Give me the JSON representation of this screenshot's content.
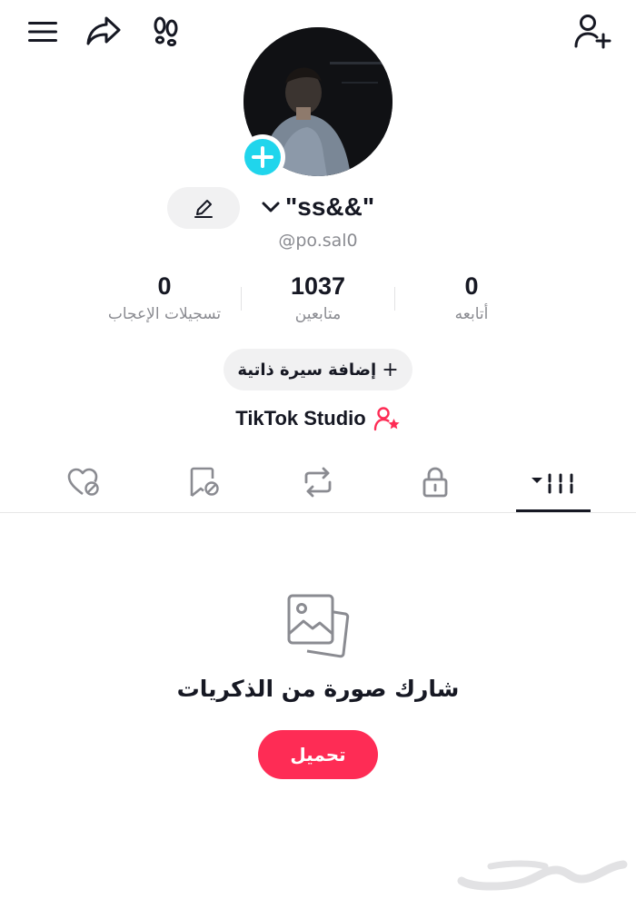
{
  "profile": {
    "display_name": "\"ss&&\"",
    "username": "@po.sal0"
  },
  "stats": [
    {
      "value": "0",
      "label": "تسجيلات الإعجاب"
    },
    {
      "value": "1037",
      "label": "متابعين"
    },
    {
      "value": "0",
      "label": "أتابعه"
    }
  ],
  "actions": {
    "add_bio_label": "إضافة سيرة ذاتية",
    "add_bio_plus": "+",
    "studio_label": "TikTok Studio"
  },
  "tabs": [
    {
      "name": "liked",
      "icon": "heart-hidden-icon"
    },
    {
      "name": "favorites",
      "icon": "bookmark-hidden-icon"
    },
    {
      "name": "reposts",
      "icon": "repost-icon"
    },
    {
      "name": "private",
      "icon": "lock-icon"
    },
    {
      "name": "videos",
      "icon": "grid-icon",
      "active": true
    }
  ],
  "empty_state": {
    "title": "شارك صورة من الذكريات",
    "button_label": "تحميل",
    "icon": "photos-icon"
  },
  "watermark_text": "حراج",
  "colors": {
    "accent": "#fe2c55",
    "add_badge": "#20d5ec",
    "text_primary": "#161823",
    "text_secondary": "#8a8b91",
    "chip_bg": "#f1f1f2"
  }
}
